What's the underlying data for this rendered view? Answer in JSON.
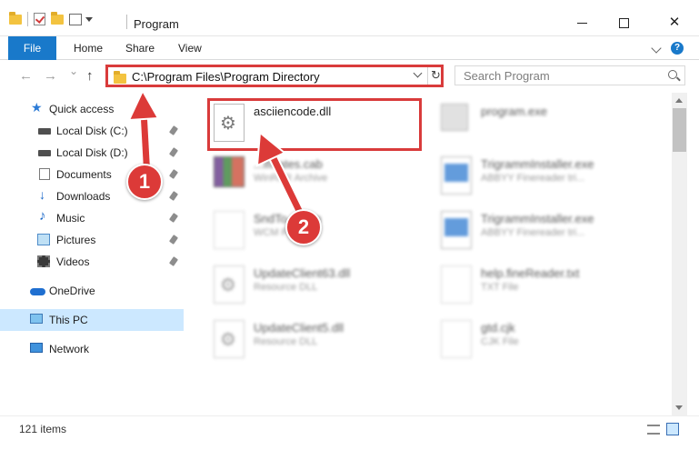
{
  "window": {
    "title": "Program",
    "minimize_glyph": "—",
    "close_glyph": "✕"
  },
  "ribbon": {
    "tabs": [
      "File",
      "Home",
      "Share",
      "View"
    ],
    "help_glyph": "?"
  },
  "navigation": {
    "back_glyph": "←",
    "forward_glyph": "→",
    "recent_glyph": "⌄",
    "up_glyph": "↑",
    "address_path": "C:\\Program Files\\Program Directory",
    "refresh_glyph": "↻",
    "search_placeholder": "Search Program"
  },
  "sidebar": {
    "quick_access": "Quick access",
    "items": [
      {
        "label": "Local Disk (C:)",
        "icon": "disk-icon",
        "pinned": true
      },
      {
        "label": "Local Disk (D:)",
        "icon": "disk-icon",
        "pinned": true
      },
      {
        "label": "Documents",
        "icon": "documents-icon",
        "pinned": true
      },
      {
        "label": "Downloads",
        "icon": "downloads-icon",
        "pinned": true
      },
      {
        "label": "Music",
        "icon": "music-icon",
        "pinned": true
      },
      {
        "label": "Pictures",
        "icon": "pictures-icon",
        "pinned": true
      },
      {
        "label": "Videos",
        "icon": "videos-icon",
        "pinned": true
      }
    ],
    "onedrive": "OneDrive",
    "this_pc": "This PC",
    "network": "Network",
    "glyphs": {
      "star": "★",
      "download": "↓",
      "music": "♪"
    }
  },
  "files": [
    {
      "name": "asciiencode.dll",
      "type": "",
      "icon": "gear-file-icon"
    },
    {
      "name": "program.exe",
      "type": "",
      "icon": "program-exe-icon"
    },
    {
      "name": "...ificates.cab",
      "type": "WinRAR Archive",
      "icon": "archive-icon"
    },
    {
      "name": "TrigrammInstaller.exe",
      "type": "ABBYY Finereader tri...",
      "icon": "installer-icon"
    },
    {
      "name": "SndTo...wcm",
      "type": "WCM File",
      "icon": "blank-file-icon"
    },
    {
      "name": "TrigrammInstaller.exe",
      "type": "ABBYY Finereader tri...",
      "icon": "installer-icon"
    },
    {
      "name": "UpdateClient63.dll",
      "type": "Resource DLL",
      "icon": "gear-file-icon"
    },
    {
      "name": "help.fineReader.txt",
      "type": "TXT File",
      "icon": "text-file-icon"
    },
    {
      "name": "UpdateClient5.dll",
      "type": "Resource DLL",
      "icon": "gear-file-icon"
    },
    {
      "name": "gtd.cjk",
      "type": "CJK File",
      "icon": "blank-file-icon"
    }
  ],
  "annotations": {
    "badge_1": "1",
    "badge_2": "2",
    "color": "#dc3a38"
  },
  "status": {
    "item_count": "121 items"
  }
}
